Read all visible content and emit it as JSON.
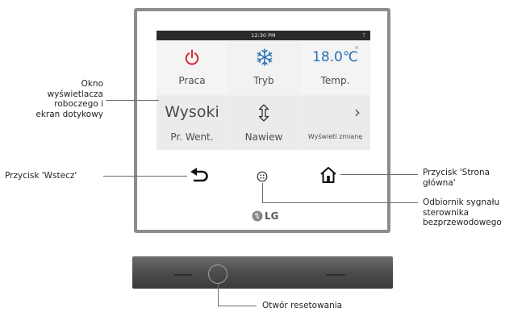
{
  "screen": {
    "status_time": "12:30 PM",
    "status_help": "?",
    "tiles": [
      {
        "value_icon": "power-icon",
        "label": "Praca"
      },
      {
        "value_icon": "snowflake-icon",
        "label": "Tryb"
      },
      {
        "value": "18.0℃",
        "label": "Temp."
      },
      {
        "value": "Wysoki",
        "label": "Pr. Went."
      },
      {
        "value_icon": "vertical-swing-icon",
        "label": "Nawiew"
      },
      {
        "value": "›",
        "label": "Wyświetl zmianę"
      }
    ]
  },
  "buttons": {
    "back_icon": "back-arrow-icon",
    "home_icon": "home-icon",
    "receiver_icon": "ir-receiver-icon"
  },
  "brand": {
    "text": "LG"
  },
  "callouts": {
    "display": "Okno\nwyświetlacza\nroboczego i\nekran dotykowy",
    "back": "Przycisk 'Wstecz'",
    "home": "Przycisk 'Strona\ngłówna'",
    "receiver": "Odbiornik sygnału\nsterownika\nbezprzewodowego",
    "reset": "Otwór resetowania"
  },
  "colors": {
    "power": "#d9262a",
    "snow": "#2a6fb6",
    "temp": "#2a6fb6",
    "frame": "#8c8c8c"
  }
}
